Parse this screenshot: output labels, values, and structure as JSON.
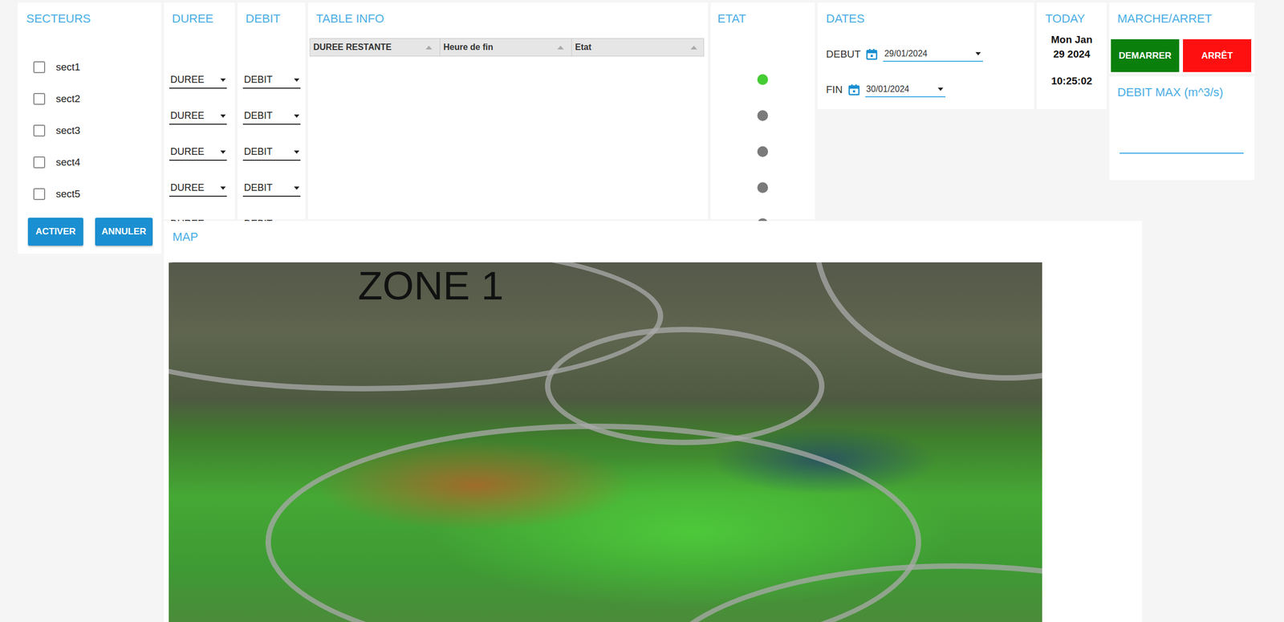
{
  "sectors": {
    "title": "SECTEURS",
    "items": [
      {
        "label": "sect1",
        "checked": false
      },
      {
        "label": "sect2",
        "checked": false
      },
      {
        "label": "sect3",
        "checked": false
      },
      {
        "label": "sect4",
        "checked": false
      },
      {
        "label": "sect5",
        "checked": false
      }
    ],
    "buttons": [
      "ACTIVER",
      "ANNULER"
    ]
  },
  "duree": {
    "title": "DUREE",
    "fields": [
      "DUREE",
      "DUREE",
      "DUREE",
      "DUREE",
      "DUREE"
    ]
  },
  "debit": {
    "title": "DEBIT",
    "fields": [
      "DEBIT",
      "DEBIT",
      "DEBIT",
      "DEBIT",
      "DEBIT"
    ]
  },
  "table": {
    "title": "TABLE INFO",
    "columns": [
      "DUREE RESTANTE",
      "Heure de fin",
      "Etat"
    ],
    "rows": []
  },
  "etat": {
    "title": "ETAT",
    "items": [
      {
        "color": "#44cc33"
      },
      {
        "color": "#7a7a7a"
      },
      {
        "color": "#7a7a7a"
      },
      {
        "color": "#7a7a7a"
      },
      {
        "color": "#7a7a7a"
      }
    ]
  },
  "dates": {
    "title": "DATES",
    "fields": [
      {
        "label": "DEBUT",
        "value": "29/01/2024"
      },
      {
        "label": "FIN",
        "value": "30/01/2024"
      }
    ]
  },
  "today": {
    "title": "TODAY",
    "date": "Mon Jan 29 2024",
    "time": "10:25:02"
  },
  "control": {
    "title": "MARCHE/ARRET",
    "buttons": [
      {
        "label": "DEMARRER",
        "color": "#0b7f0b"
      },
      {
        "label": "ARRÊT",
        "color": "#ff1010"
      }
    ]
  },
  "debit_max": {
    "title": "DEBIT MAX (m^3/s)",
    "value": ""
  },
  "map": {
    "title": "MAP",
    "label": "ZONE 1"
  }
}
